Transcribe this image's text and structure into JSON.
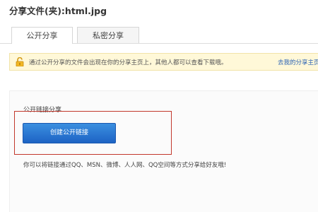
{
  "dialog": {
    "title": "分享文件(夹):html.jpg"
  },
  "tabs": [
    {
      "label": "公开分享",
      "active": true
    },
    {
      "label": "私密分享",
      "active": false
    }
  ],
  "notice": {
    "icon": "unlock-icon",
    "text": "通过公开分享的文件会出现在你的分享主页上，其他人都可以查看下载哦。",
    "link_label": "去我的分享主页"
  },
  "public_link": {
    "section_label": "公开链接分享",
    "create_button_label": "创建公开链接",
    "hint": "你可以将链接通过QQ、MSN、微博、人人网、QQ空间等方式分享给好友哦!"
  },
  "colors": {
    "accent_blue": "#2a6fd0",
    "highlight_red": "#c2382c",
    "notice_bg": "#fff8d8",
    "link_blue": "#2a62b5"
  }
}
